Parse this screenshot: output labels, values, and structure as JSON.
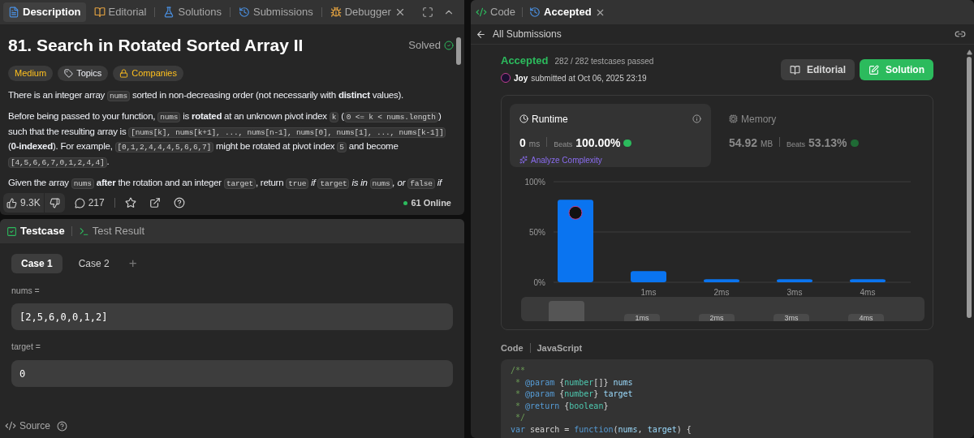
{
  "left_tabs": [
    {
      "label": "Description",
      "selected": true,
      "closable": false
    },
    {
      "label": "Editorial",
      "selected": false,
      "closable": false
    },
    {
      "label": "Solutions",
      "selected": false,
      "closable": false
    },
    {
      "label": "Submissions",
      "selected": false,
      "closable": false
    },
    {
      "label": "Debugger",
      "selected": false,
      "closable": true
    }
  ],
  "problem": {
    "title": "81. Search in Rotated Sorted Array II",
    "status": "Solved",
    "tags": [
      {
        "label": "Medium",
        "kind": "difficulty"
      },
      {
        "label": "Topics",
        "kind": "topics"
      },
      {
        "label": "Companies",
        "kind": "companies"
      }
    ],
    "paragraphs": [
      [
        {
          "kind": "text",
          "text": "There is an integer array "
        },
        {
          "kind": "code",
          "text": "nums"
        },
        {
          "kind": "text",
          "text": " sorted in non-decreasing order (not necessarily with **distinct** values)."
        }
      ],
      [
        {
          "kind": "text",
          "text": "Before being passed to your function, "
        },
        {
          "kind": "code",
          "text": "nums"
        },
        {
          "kind": "text",
          "text": " is **rotated** at an unknown pivot index "
        },
        {
          "kind": "code",
          "text": "k"
        },
        {
          "kind": "text",
          "text": " ("
        },
        {
          "kind": "code",
          "text": "0 <= k < nums.length"
        },
        {
          "kind": "text",
          "text": ") such that the resulting array is "
        },
        {
          "kind": "code",
          "text": "[nums[k], nums[k+1], ..., nums[n-1], nums[0], nums[1], ..., nums[k-1]]"
        },
        {
          "kind": "text",
          "text": " (**0-indexed**). For example, "
        },
        {
          "kind": "code",
          "text": "[0,1,2,4,4,4,5,6,6,7]"
        },
        {
          "kind": "text",
          "text": " might be rotated at pivot index "
        },
        {
          "kind": "code",
          "text": "5"
        },
        {
          "kind": "text",
          "text": " and become "
        },
        {
          "kind": "code",
          "text": "[4,5,6,6,7,0,1,2,4,4]"
        },
        {
          "kind": "text",
          "text": "."
        }
      ],
      [
        {
          "kind": "text",
          "text": "Given the array "
        },
        {
          "kind": "code",
          "text": "nums"
        },
        {
          "kind": "text",
          "text": " **after** the rotation and an integer "
        },
        {
          "kind": "code",
          "text": "target"
        },
        {
          "kind": "text",
          "text": ", return "
        },
        {
          "kind": "code",
          "text": "true"
        },
        {
          "kind": "text",
          "text": " *if* "
        },
        {
          "kind": "code",
          "text": "target"
        },
        {
          "kind": "text",
          "text": " *is in* "
        },
        {
          "kind": "code",
          "text": "nums"
        },
        {
          "kind": "text",
          "text": "*, or* "
        },
        {
          "kind": "code",
          "text": "false"
        },
        {
          "kind": "text",
          "text": " *if*"
        }
      ]
    ]
  },
  "footer": {
    "likes": "9.3K",
    "comments": "217",
    "online": "61 Online"
  },
  "test_tabs": [
    {
      "label": "Testcase",
      "selected": true
    },
    {
      "label": "Test Result",
      "selected": false
    }
  ],
  "cases": [
    {
      "label": "Case 1",
      "selected": true
    },
    {
      "label": "Case 2",
      "selected": false
    }
  ],
  "add_case": "+",
  "inputs": [
    {
      "label": "nums =",
      "value": "[2,5,6,0,0,1,2]"
    },
    {
      "label": "target =",
      "value": "0"
    }
  ],
  "source": "Source",
  "right_tabs": [
    {
      "label": "Code",
      "selected": false,
      "closable": false
    },
    {
      "label": "Accepted",
      "selected": true,
      "closable": true
    }
  ],
  "back_link": "All Submissions",
  "result": {
    "status": "Accepted",
    "passed": "282 / 282 testcases passed",
    "user": "Joy",
    "submitted": "submitted at Oct 06, 2025 23:19"
  },
  "buttons": [
    {
      "label": "Editorial",
      "kind": "secondary"
    },
    {
      "label": "Solution",
      "kind": "primary"
    }
  ],
  "stats": [
    {
      "title": "Runtime",
      "value": "0",
      "unit": "ms",
      "beats_label": "Beats",
      "beats": "100.00%",
      "selected": true,
      "link": "Analyze Complexity"
    },
    {
      "title": "Memory",
      "value": "54.92",
      "unit": "MB",
      "beats_label": "Beats",
      "beats": "53.13%",
      "selected": false
    }
  ],
  "chart_data": {
    "type": "bar",
    "categories": [
      null,
      "1ms",
      "2ms",
      "3ms",
      "4ms"
    ],
    "values": [
      82,
      11,
      3,
      3,
      3
    ],
    "ylim": [
      0,
      100
    ],
    "yticks": [
      {
        "value": 0,
        "label": "0%"
      },
      {
        "value": 50,
        "label": "50%"
      },
      {
        "value": 100,
        "label": "100%"
      }
    ]
  },
  "navigator_labels": [
    "1ms",
    "2ms",
    "3ms",
    "4ms"
  ],
  "code_header": {
    "title": "Code",
    "language": "JavaScript"
  },
  "code_lines": [
    [
      {
        "kind": "comment",
        "text": "/**"
      }
    ],
    [
      {
        "kind": "comment",
        "text": " * "
      },
      {
        "kind": "tag",
        "text": "@param"
      },
      {
        "kind": "plain",
        "text": " {"
      },
      {
        "kind": "type",
        "text": "number"
      },
      {
        "kind": "plain",
        "text": "[]} "
      },
      {
        "kind": "name",
        "text": "nums"
      }
    ],
    [
      {
        "kind": "comment",
        "text": " * "
      },
      {
        "kind": "tag",
        "text": "@param"
      },
      {
        "kind": "plain",
        "text": " {"
      },
      {
        "kind": "type",
        "text": "number"
      },
      {
        "kind": "plain",
        "text": "} "
      },
      {
        "kind": "name",
        "text": "target"
      }
    ],
    [
      {
        "kind": "comment",
        "text": " * "
      },
      {
        "kind": "tag",
        "text": "@return"
      },
      {
        "kind": "plain",
        "text": " {"
      },
      {
        "kind": "type",
        "text": "boolean"
      },
      {
        "kind": "plain",
        "text": "}"
      }
    ],
    [
      {
        "kind": "comment",
        "text": " */"
      }
    ],
    [
      {
        "kind": "keyword",
        "text": "var"
      },
      {
        "kind": "plain",
        "text": " search = "
      },
      {
        "kind": "keyword",
        "text": "function"
      },
      {
        "kind": "plain",
        "text": "("
      },
      {
        "kind": "name",
        "text": "nums"
      },
      {
        "kind": "plain",
        "text": ", "
      },
      {
        "kind": "name",
        "text": "target"
      },
      {
        "kind": "plain",
        "text": ") {"
      }
    ]
  ]
}
